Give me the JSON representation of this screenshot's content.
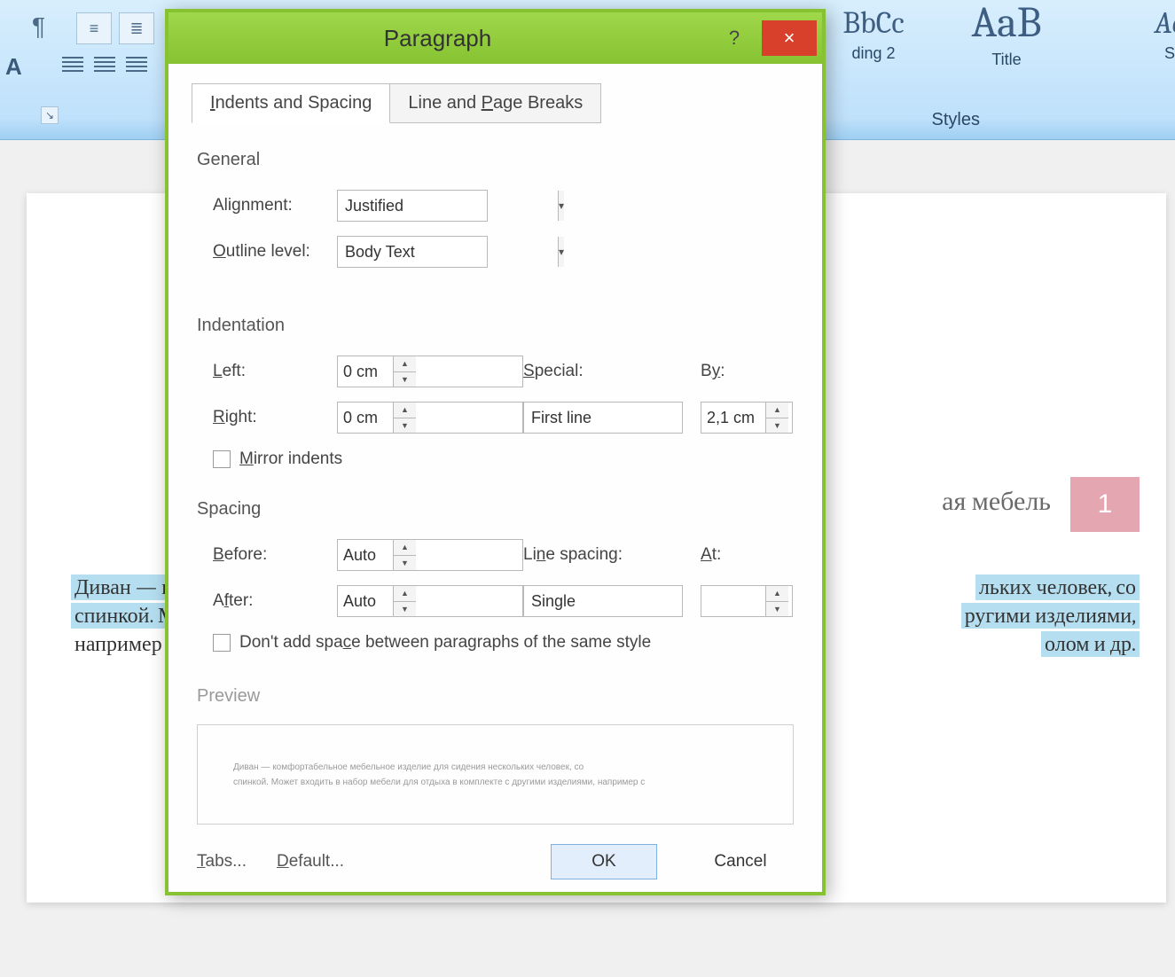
{
  "ribbon": {
    "style_heading2_sample": "BbCc",
    "style_heading2_label": "ding 2",
    "style_title_sample": "AaB",
    "style_title_label": "Title",
    "style_sub_sample": "Ac",
    "style_sub_label": "S",
    "styles_caption": "Styles"
  },
  "background_doc": {
    "heading_right": "ая мебель",
    "heading_number": "1",
    "line1_left": "Диван — ко",
    "line1_right": "льких человек, со",
    "line2_left": "спинкой. Мож",
    "line2_right": "ругими изделиями,",
    "line3_left": "например с к",
    "line3_right": "олом и др."
  },
  "dialog": {
    "title": "Paragraph",
    "help_symbol": "?",
    "close_symbol": "×",
    "tabs": {
      "indents": "Indents and Spacing",
      "breaks": "Line and Page Breaks"
    },
    "general": {
      "title": "General",
      "alignment_label": "Alignment:",
      "alignment_value": "Justified",
      "outline_label": "Outline level:",
      "outline_value": "Body Text"
    },
    "indentation": {
      "title": "Indentation",
      "left_label": "Left:",
      "left_value": "0 cm",
      "right_label": "Right:",
      "right_value": "0 cm",
      "special_label": "Special:",
      "special_value": "First line",
      "by_label": "By:",
      "by_value": "2,1 cm",
      "mirror_label": "Mirror indents"
    },
    "spacing": {
      "title": "Spacing",
      "before_label": "Before:",
      "before_value": "Auto",
      "after_label": "After:",
      "after_value": "Auto",
      "line_label": "Line spacing:",
      "line_value": "Single",
      "at_label": "At:",
      "at_value": "",
      "dont_add_label": "Don't add space between paragraphs of the same style"
    },
    "preview": {
      "title": "Preview",
      "line1": "Диван —   комфортабельное    мебельное   изделие   для   сидения   нескольких   человек,   со",
      "line2": "спинкой. Может входить в набор мебели для отдыха в комплекте с другими изделиями, например с"
    },
    "buttons": {
      "tabs": "Tabs...",
      "default": "Default...",
      "ok": "OK",
      "cancel": "Cancel"
    }
  }
}
